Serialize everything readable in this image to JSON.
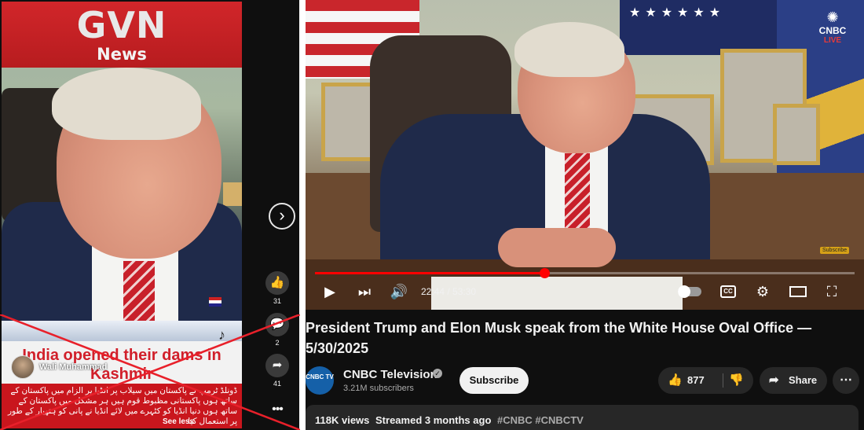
{
  "left_panel": {
    "banner_title": "GVN",
    "banner_subtitle": "News",
    "headline": "India opened their dams in Kashmir",
    "username": "Wali Muhammad",
    "tiktok_icon": "tiktok-icon",
    "urdu_caption": "ڈونلڈ ٹرمپ نے پاکستان میں سیلاب پر انڈیا پر الزام میں پاکستان کے ساتھ ہوں پاکستانی مظبوط قوم ہیں ہر مشکل میں پاکستان کے ساتھ ہوں دنیا انڈیا کو کٹہرے میں لائے انڈیا نے پانی کو ہتھیار کے طور پر استعمال کیا",
    "see_less": "See less",
    "actions": {
      "like_count": "31",
      "comment_count": "2",
      "share_count": "41"
    },
    "x_color": "#e8202a"
  },
  "player": {
    "channel_logo_word": "CNBC",
    "live_label": "LIVE",
    "subscribe_tag": "Subscribe",
    "time_current": "22:44",
    "time_total": "53:30",
    "time_display": "22:44 / 53:30",
    "progress": 0.425,
    "cc_label": "CC"
  },
  "video": {
    "title": "President Trump and Elon Musk speak from the White House Oval Office — 5/30/2025",
    "channel_name": "CNBC Television",
    "channel_avatar_text": "CNBC TV",
    "subscribers": "3.21M subscribers",
    "subscribe_label": "Subscribe",
    "like_count": "877",
    "share_label": "Share",
    "views": "118K views",
    "streamed": "Streamed 3 months ago",
    "hashtags": "#CNBC #CNBCTV"
  }
}
